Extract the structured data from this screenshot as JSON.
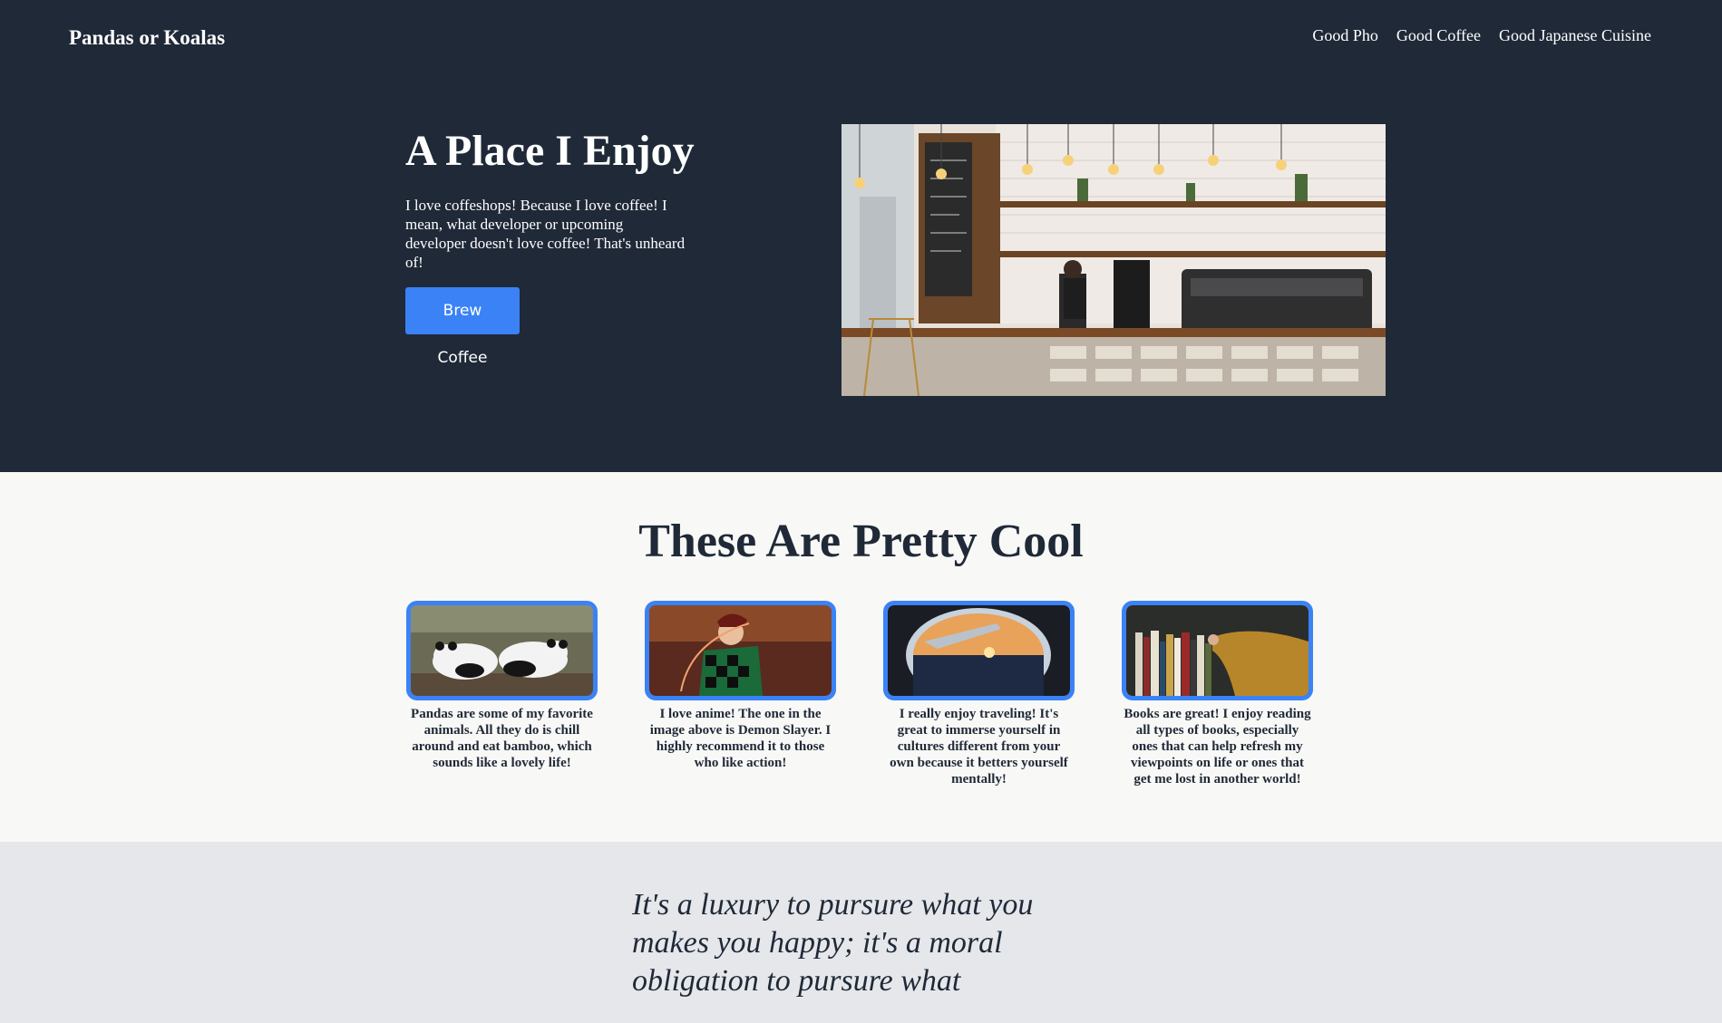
{
  "nav": {
    "brand": "Pandas or Koalas",
    "links": [
      "Good Pho",
      "Good Coffee",
      "Good Japanese Cuisine"
    ]
  },
  "hero": {
    "title": "A Place I Enjoy",
    "body": "I love coffeshops! Because I love coffee! I mean, what developer or upcoming developer doesn't love coffee! That's unheard of!",
    "button": "Brew Coffee",
    "image": "coffee-shop-photo"
  },
  "cool": {
    "title": "These Are Pretty Cool",
    "cards": [
      {
        "image": "pandas-photo",
        "text": "Pandas are some of my favorite animals. All they do is chill around and eat bamboo, which sounds like a lovely life!"
      },
      {
        "image": "demon-slayer-photo",
        "text": "I love anime! The one in the image above is Demon Slayer. I highly recommend it to those who like action!"
      },
      {
        "image": "airplane-window-photo",
        "text": "I really enjoy traveling! It's great to immerse yourself in cultures different from your own because it betters yourself mentally!"
      },
      {
        "image": "bookshelf-photo",
        "text": "Books are great! I enjoy reading all types of books, especially ones that can help refresh my viewpoints on life or ones that get me lost in another world!"
      }
    ]
  },
  "quote": {
    "text": "It's a luxury to pursure what you makes you happy; it's a moral obligation to pursure what"
  },
  "colors": {
    "dark": "#1f2937",
    "accent": "#3b82f6",
    "light": "#f8f8f6",
    "gray": "#e5e7eb"
  }
}
